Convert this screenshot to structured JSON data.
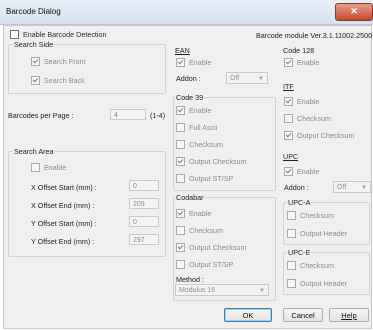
{
  "window": {
    "title": "Barcode Dialog",
    "close": "✕"
  },
  "enable_detection": {
    "label": "Enable Barcode Detection",
    "checked": false
  },
  "module_version": "Barcode module Ver.3.1.11002.2500",
  "search_side": {
    "title": "Search Side",
    "front": "Search Front",
    "back": "Search Back"
  },
  "barcodes_per_page": {
    "label": "Barcodes per Page :",
    "value": "4",
    "range": "(1-4)"
  },
  "search_area": {
    "title": "Search Area",
    "enable": "Enable",
    "x_start_label": "X Offset Start (mm) :",
    "x_start": "0",
    "x_end_label": "X Offset End (mm) :",
    "x_end": "209",
    "y_start_label": "Y Offset Start (mm) :",
    "y_start": "0",
    "y_end_label": "Y Offset End (mm) :",
    "y_end": "297"
  },
  "ean": {
    "title": "EAN",
    "enable": "Enable",
    "addon_label": "Addon :",
    "addon_value": "Off"
  },
  "code39": {
    "title": "Code 39",
    "enable": "Enable",
    "full_ascii": "Full Ascii",
    "checksum": "Checksum",
    "output_checksum": "Output Checksum",
    "output_stsp": "Output ST/SP"
  },
  "codabar": {
    "title": "Codabar",
    "enable": "Enable",
    "checksum": "Checksum",
    "output_checksum": "Output Checksum",
    "output_stsp": "Output ST/SP",
    "method_label": "Method :",
    "method_value": "Modulus 16"
  },
  "code128": {
    "title": "Code 128",
    "enable": "Enable"
  },
  "itf": {
    "title": "ITF",
    "enable": "Enable",
    "checksum": "Checksum",
    "output_checksum": "Output Checksum"
  },
  "upc": {
    "title": "UPC",
    "enable": "Enable",
    "addon_label": "Addon :",
    "addon_value": "Off",
    "upca": {
      "title": "UPC-A",
      "checksum": "Checksum",
      "output_header": "Output Header"
    },
    "upce": {
      "title": "UPC-E",
      "checksum": "Checksum",
      "output_header": "Output Header"
    }
  },
  "buttons": {
    "ok": "OK",
    "cancel": "Cancel",
    "help": "Help"
  }
}
